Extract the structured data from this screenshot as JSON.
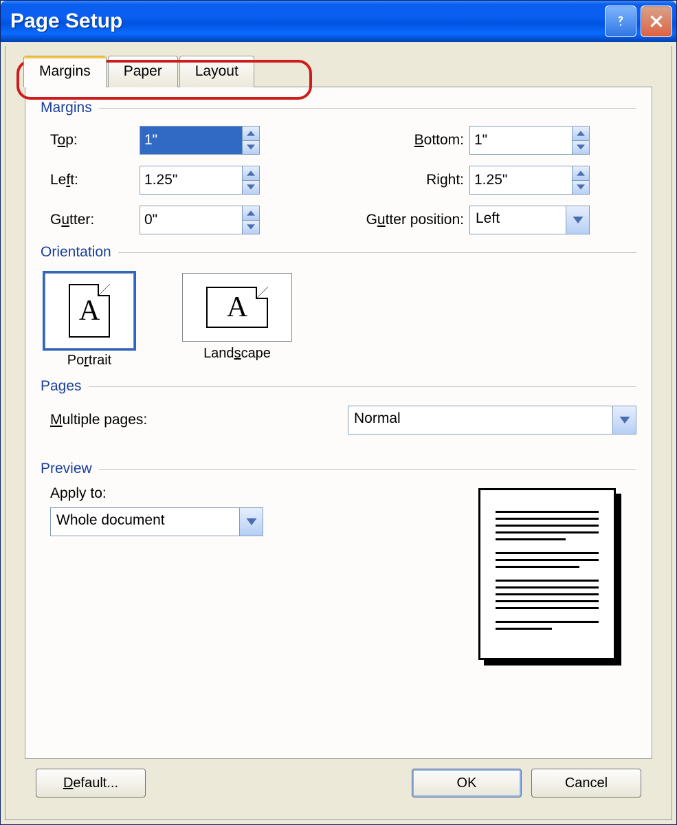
{
  "title": "Page Setup",
  "tabs": {
    "margins": "Margins",
    "paper": "Paper",
    "layout": "Layout",
    "active": "margins"
  },
  "sections": {
    "margins": "Margins",
    "orientation": "Orientation",
    "pages": "Pages",
    "preview": "Preview"
  },
  "margins": {
    "top_label_pre": "T",
    "top_label_u": "o",
    "top_label_post": "p:",
    "top": "1\"",
    "bottom_label_pre": "",
    "bottom_label_u": "B",
    "bottom_label_post": "ottom:",
    "bottom": "1\"",
    "left_label_pre": "Le",
    "left_label_u": "f",
    "left_label_post": "t:",
    "left": "1.25\"",
    "right_label_pre": "Ri",
    "right_label_u": "g",
    "right_label_post": "ht:",
    "right": "1.25\"",
    "gutter_label_pre": "G",
    "gutter_label_u": "u",
    "gutter_label_post": "tter:",
    "gutter": "0\"",
    "gutterpos_label_pre": "G",
    "gutterpos_label_u": "u",
    "gutterpos_label_post": "tter position:",
    "gutterpos": "Left"
  },
  "orientation": {
    "portrait_pre": "Po",
    "portrait_u": "r",
    "portrait_post": "trait",
    "landscape_pre": "Land",
    "landscape_u": "s",
    "landscape_post": "cape",
    "selected": "portrait"
  },
  "pages": {
    "label_pre": "",
    "label_u": "M",
    "label_post": "ultiple pages:",
    "value": "Normal"
  },
  "preview": {
    "applyto_label": "Apply to:",
    "applyto_value": "Whole document"
  },
  "buttons": {
    "default_pre": "",
    "default_u": "D",
    "default_post": "efault...",
    "ok": "OK",
    "cancel": "Cancel"
  }
}
